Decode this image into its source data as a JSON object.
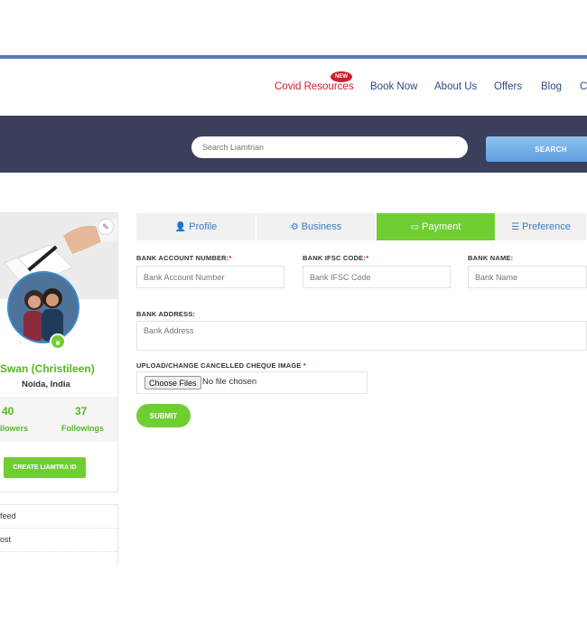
{
  "nav": {
    "new_badge": "NEW",
    "items": [
      "Covid Resources",
      "Book Now",
      "About Us",
      "Offers",
      "Blog",
      "C"
    ]
  },
  "search": {
    "placeholder": "Search Liamtrian",
    "button": "SEARCH"
  },
  "profile": {
    "name": "Swan (Christileen)",
    "location": "Noida, India",
    "followers_count": "40",
    "followers_label": "llowers",
    "followings_count": "37",
    "followings_label": "Followings",
    "create_button": "CREATE LIAMTRA ID",
    "menu": [
      "feed",
      "ost"
    ]
  },
  "tabs": [
    {
      "label": "Profile",
      "icon": "user-cog-icon"
    },
    {
      "label": "Business",
      "icon": "gear-icon"
    },
    {
      "label": "Payment",
      "icon": "card-icon",
      "active": true
    },
    {
      "label": "Preference",
      "icon": "sliders-icon"
    }
  ],
  "form": {
    "account_label": "BANK ACCOUNT NUMBER:",
    "account_placeholder": "Bank Account Number",
    "ifsc_label": "BANK IFSC CODE:",
    "ifsc_placeholder": "Bank IFSC Code",
    "bankname_label": "BANK NAME:",
    "bankname_placeholder": "Bank Name",
    "address_label": "BANK ADDRESS:",
    "address_placeholder": "Bank Address",
    "cheque_label": "UPLOAD/CHANGE CANCELLED CHEQUE IMAGE",
    "required_mark": "*",
    "choose_button": "Choose Files",
    "no_file": "No file chosen",
    "submit": "SUBMIT"
  },
  "colors": {
    "accent_green": "#6fce31",
    "nav_blue": "#2c4a8a",
    "band": "#3b3f5c",
    "alert_red": "#d0202a"
  }
}
